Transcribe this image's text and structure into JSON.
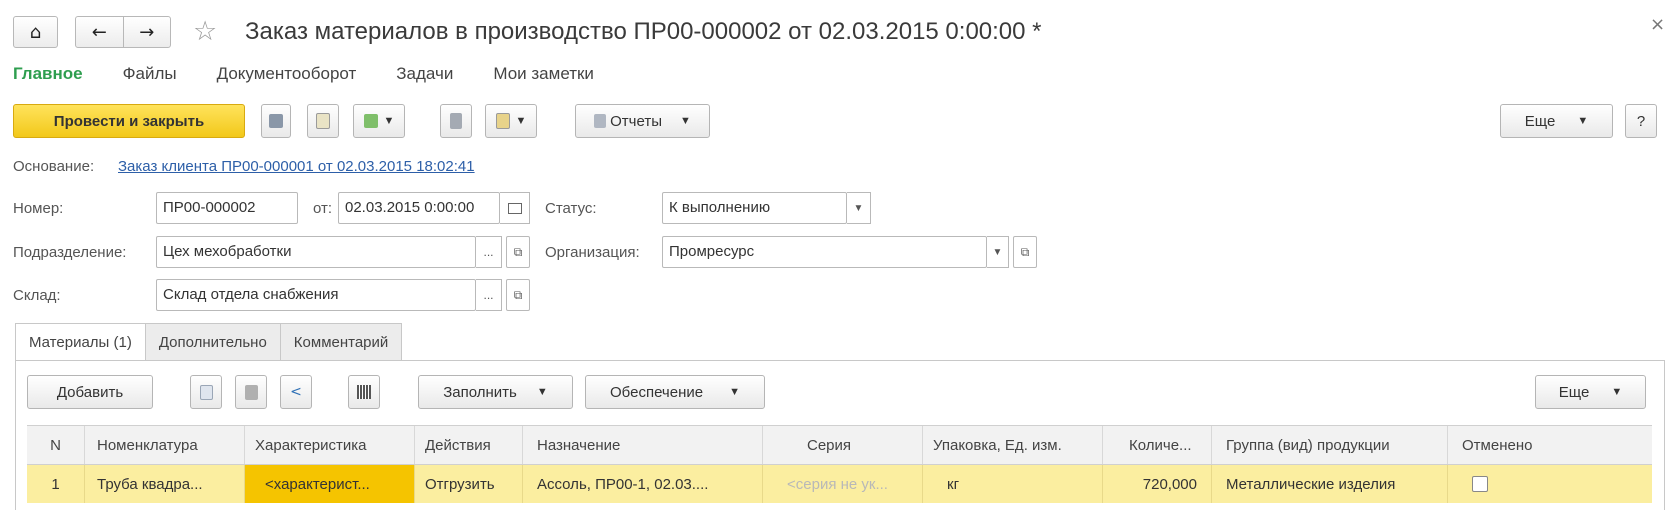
{
  "window": {
    "title": "Заказ материалов в производство ПР00-000002 от 02.03.2015 0:00:00 *",
    "close_glyph": "×"
  },
  "nav": {
    "home_icon": "home-icon",
    "back_icon": "arrow-left-icon",
    "forward_icon": "arrow-right-icon",
    "star_icon": "star-icon"
  },
  "sections": [
    "Главное",
    "Файлы",
    "Документооборот",
    "Задачи",
    "Мои заметки"
  ],
  "toolbar": {
    "post_close": "Провести и закрыть",
    "reports": "Отчеты",
    "more": "Еще",
    "help": "?"
  },
  "form": {
    "basis_label": "Основание:",
    "basis_link": "Заказ клиента ПР00-000001 от 02.03.2015 18:02:41",
    "number_label": "Номер:",
    "number_value": "ПР00-000002",
    "from_label": "от:",
    "date_value": "02.03.2015  0:00:00",
    "status_label": "Статус:",
    "status_value": "К выполнению",
    "division_label": "Подразделение:",
    "division_value": "Цех мехобработки",
    "org_label": "Организация:",
    "org_value": "Промресурс",
    "warehouse_label": "Склад:",
    "warehouse_value": "Склад отдела снабжения",
    "ellipsis": "...",
    "open_glyph": "⧉"
  },
  "tabs": [
    "Материалы (1)",
    "Дополнительно",
    "Комментарий"
  ],
  "table_toolbar": {
    "add": "Добавить",
    "fill": "Заполнить",
    "supply": "Обеспечение",
    "more": "Еще"
  },
  "table": {
    "columns": [
      "N",
      "Номенклатура",
      "Характеристика",
      "Действия",
      "Назначение",
      "Серия",
      "Упаковка, Ед. изм.",
      "Количе...",
      "Группа (вид) продукции",
      "Отменено"
    ],
    "rows": [
      [
        "1",
        "Труба квадра...",
        "<характерист...",
        "Отгрузить",
        "Ассоль, ПР00-1, 02.03....",
        "<серия не ук...",
        "кг",
        "720,000",
        "Металлические изделия",
        ""
      ]
    ]
  }
}
